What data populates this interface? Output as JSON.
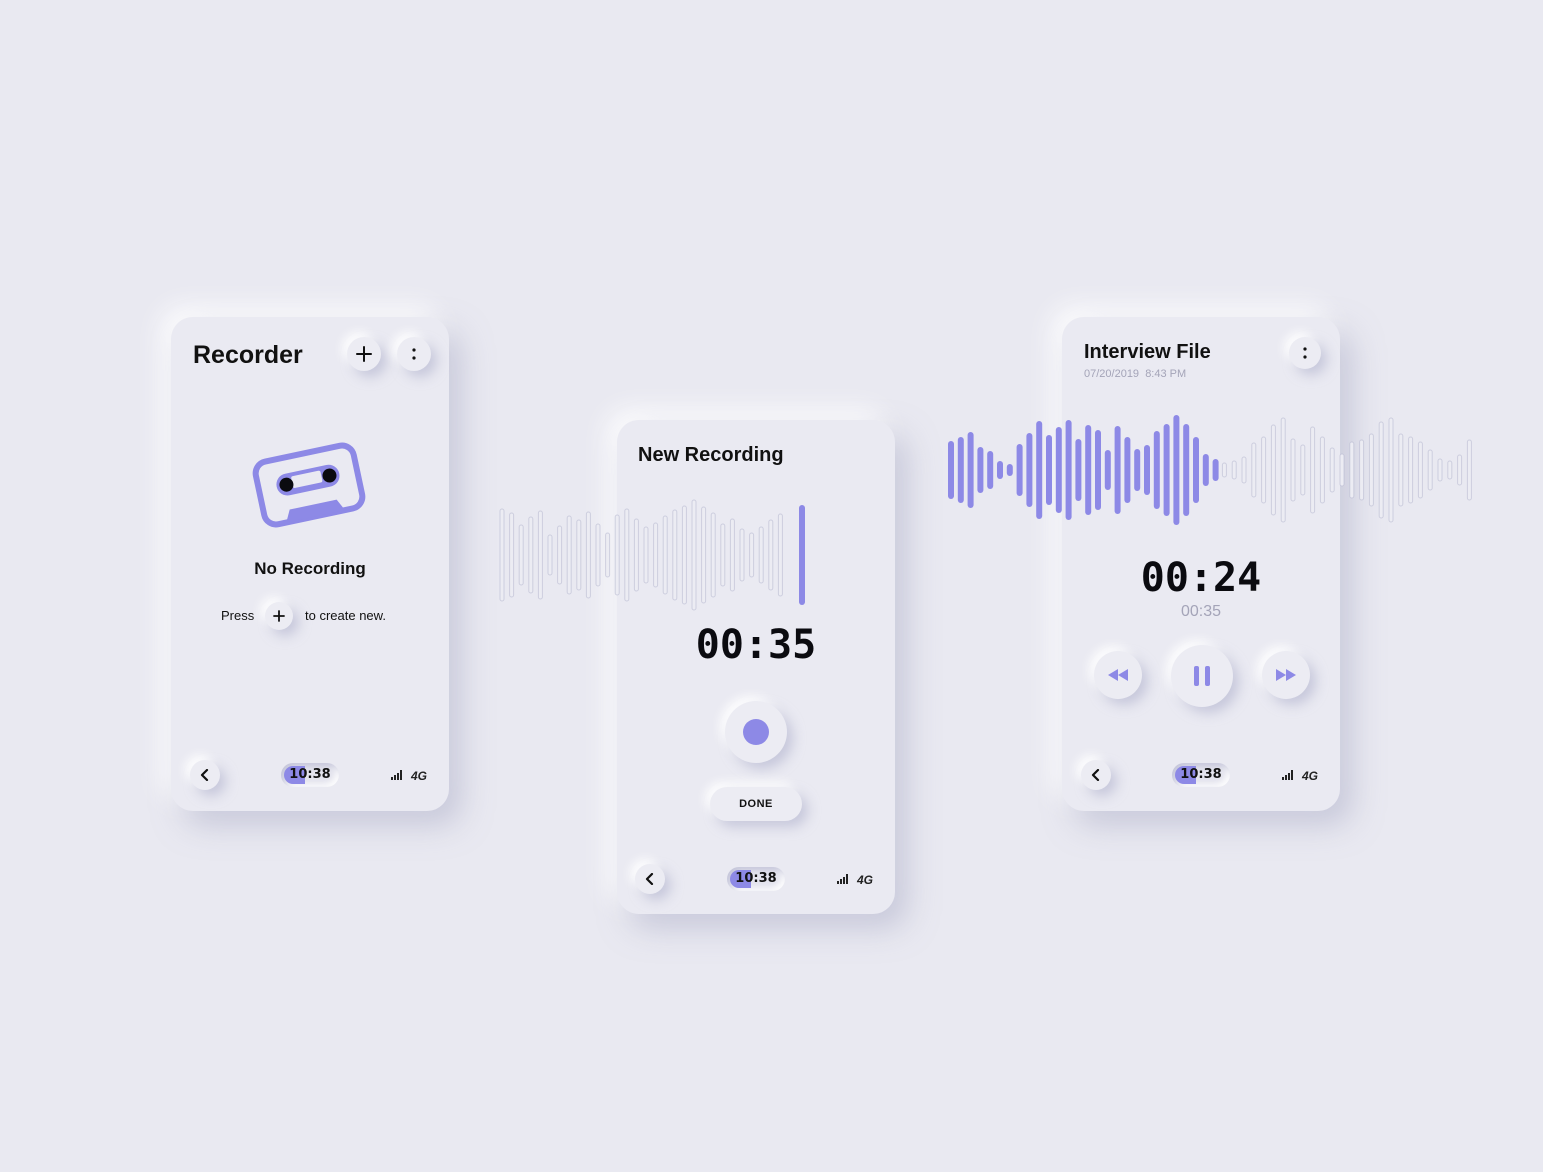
{
  "colors": {
    "background": "#e9e9f1",
    "accent": "#8d89e6",
    "text": "#111111",
    "muted": "#a4a4b8"
  },
  "status_bar": {
    "time": "10:38",
    "network": "4G"
  },
  "recorder": {
    "title": "Recorder",
    "empty_title": "No Recording",
    "hint_before": "Press",
    "hint_after": "to create new.",
    "icons": [
      "plus-icon",
      "more-vertical-icon",
      "cassette-icon",
      "chevron-left-icon"
    ]
  },
  "new_recording": {
    "title": "New Recording",
    "timer": "00:35",
    "done_label": "DONE",
    "icons": [
      "record-icon",
      "chevron-left-icon"
    ]
  },
  "interview": {
    "title": "Interview File",
    "date": "07/20/2019",
    "time": "8:43 PM",
    "current_time": "00:24",
    "total_time": "00:35",
    "progress": 0.686,
    "icons": [
      "rewind-icon",
      "pause-icon",
      "fast-forward-icon",
      "more-vertical-icon",
      "chevron-left-icon"
    ]
  }
}
